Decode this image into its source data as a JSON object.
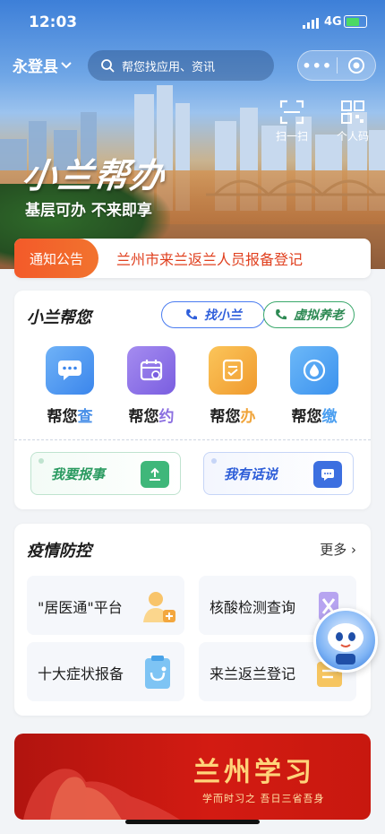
{
  "status_bar": {
    "time": "12:03",
    "network": "4G"
  },
  "header": {
    "county": "永登县",
    "search_placeholder": "帮您找应用、资讯",
    "capsule_more": "•••"
  },
  "quick_tools": [
    {
      "label": "扫一扫",
      "icon": "scan-icon"
    },
    {
      "label": "个人码",
      "icon": "qr-code-icon"
    }
  ],
  "hero": {
    "slogan_art": "小兰帮办",
    "slogan_sub": "基层可办 不来即享"
  },
  "notice": {
    "tag": "通知公告",
    "text": "兰州市来兰返兰人员报备登记"
  },
  "help_section": {
    "title": "小兰帮您",
    "buttons": [
      {
        "label": "找小兰",
        "icon": "phone-icon"
      },
      {
        "label": "虚拟养老",
        "icon": "phone-icon"
      }
    ],
    "services": [
      {
        "prefix": "帮您",
        "suffix": "查",
        "color": "#4a90e8",
        "icon": "chat-icon"
      },
      {
        "prefix": "帮您",
        "suffix": "约",
        "color": "#8b6fe0",
        "icon": "calendar-icon"
      },
      {
        "prefix": "帮您",
        "suffix": "办",
        "color": "#f0a43a",
        "icon": "document-icon"
      },
      {
        "prefix": "帮您",
        "suffix": "缴",
        "color": "#4a9ef0",
        "icon": "water-drop-icon"
      }
    ],
    "reports": [
      {
        "label": "我要报事",
        "icon": "upload-icon",
        "color": "#3fb77a"
      },
      {
        "label": "我有话说",
        "icon": "message-icon",
        "color": "#3c6fe0"
      }
    ]
  },
  "epidemic_section": {
    "title": "疫情防控",
    "more": "更多",
    "tiles": [
      {
        "label": "\"居医通\"平台",
        "icon": "doctor-icon"
      },
      {
        "label": "核酸检测查询",
        "icon": "test-tube-icon"
      },
      {
        "label": "十大症状报备",
        "icon": "clipboard-icon"
      },
      {
        "label": "来兰返兰登记",
        "icon": "register-icon"
      }
    ]
  },
  "banner": {
    "title": "兰州学习",
    "subtitle": "学而时习之 吾日三省吾身"
  }
}
